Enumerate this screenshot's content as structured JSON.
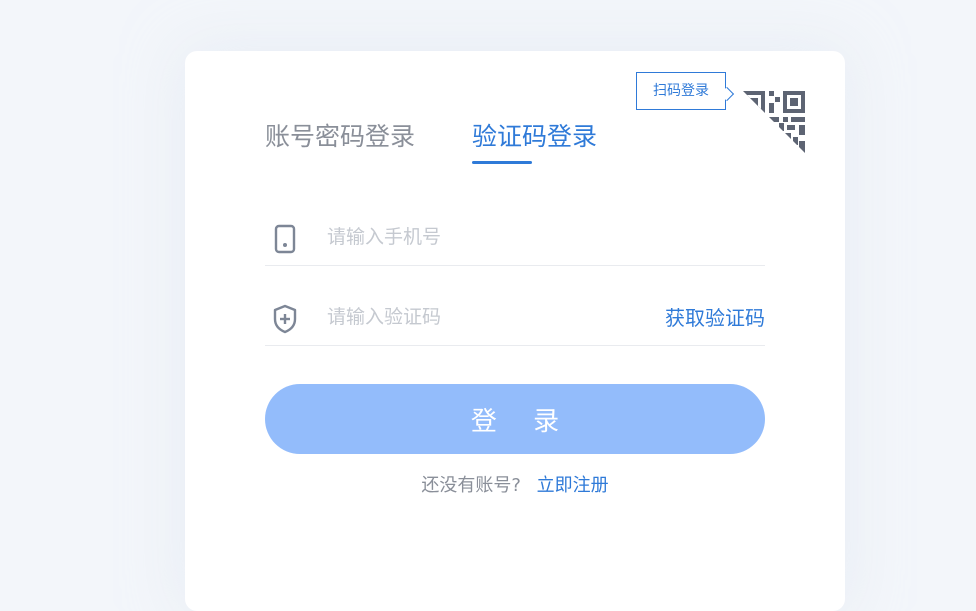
{
  "tabs": {
    "password_login": "账号密码登录",
    "code_login": "验证码登录"
  },
  "qr": {
    "tooltip": "扫码登录"
  },
  "phone_field": {
    "placeholder": "请输入手机号"
  },
  "code_field": {
    "placeholder": "请输入验证码",
    "get_code_label": "获取验证码"
  },
  "login_button": {
    "label": "登 录"
  },
  "register": {
    "prompt": "还没有账号?",
    "link": "立即注册"
  },
  "colors": {
    "accent": "#2f7ad8",
    "button": "#93bcfb",
    "background": "#f3f6fa",
    "muted_text": "#8a8f99",
    "placeholder": "#c5c9d0"
  }
}
